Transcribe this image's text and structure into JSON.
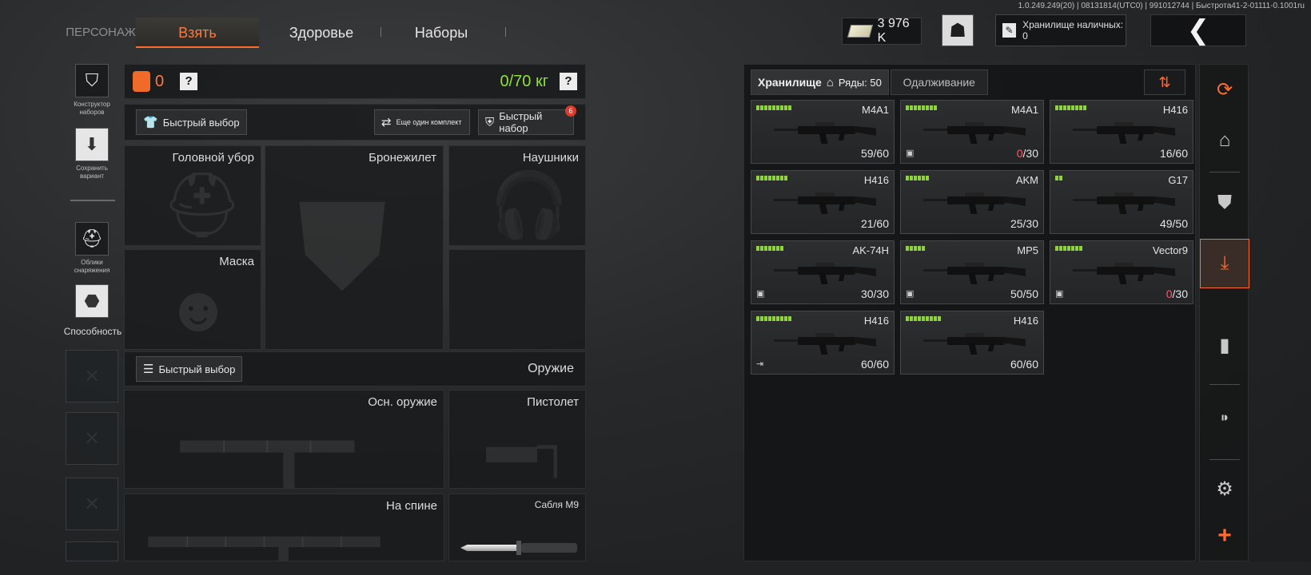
{
  "version": "1.0.249.249(20) | 08131814(UTC0) | 991012744 | Быстрота41-2-01111-0.1001ru",
  "tabs": {
    "character": "ПЕРСОНАЖ",
    "take": "Взять",
    "health": "Здоровье",
    "sets": "Наборы"
  },
  "currency": {
    "amount": "3 976 K"
  },
  "storage_cash": {
    "label": "Хранилище наличных: 0"
  },
  "sidebar": {
    "kit_builder": "Конструктор наборов",
    "save_variant": "Сохранить вариант",
    "gear_skins": "Облики снаряжения",
    "ability": "Способность"
  },
  "loadout": {
    "bag_count": "0",
    "help_glyph": "?",
    "weight": "0/70 кг",
    "quick_select": "Быстрый выбор",
    "another_kit": "Еще один комплект",
    "quick_kit": "Быстрый набор",
    "quick_kit_badge": "6",
    "slots": {
      "headwear": "Головной убор",
      "vest": "Бронежилет",
      "headphones": "Наушники",
      "mask": "Маска"
    },
    "weapons_quick_select": "Быстрый выбор",
    "weapons_title": "Оружие",
    "weapon_slots": {
      "primary": "Осн. оружие",
      "pistol": "Пистолет",
      "back": "На спине",
      "melee": "Сабля М9"
    }
  },
  "storage": {
    "tab_storage": "Хранилище",
    "rows_label": "Ряды: 50",
    "tab_borrow": "Одалживание",
    "items": [
      {
        "name": "M4A1",
        "ammo_current": "59",
        "ammo_max": "/60",
        "empty": false,
        "pips": 9,
        "corner_icon": ""
      },
      {
        "name": "M4A1",
        "ammo_current": "0",
        "ammo_max": "/30",
        "empty": true,
        "pips": 8,
        "corner_icon": "box-icon"
      },
      {
        "name": "H416",
        "ammo_current": "16",
        "ammo_max": "/60",
        "empty": false,
        "pips": 8,
        "corner_icon": ""
      },
      {
        "name": "H416",
        "ammo_current": "21",
        "ammo_max": "/60",
        "empty": false,
        "pips": 8,
        "corner_icon": ""
      },
      {
        "name": "AKM",
        "ammo_current": "25",
        "ammo_max": "/30",
        "empty": false,
        "pips": 6,
        "corner_icon": ""
      },
      {
        "name": "G17",
        "ammo_current": "49",
        "ammo_max": "/50",
        "empty": false,
        "pips": 2,
        "corner_icon": ""
      },
      {
        "name": "AK-74H",
        "ammo_current": "30",
        "ammo_max": "/30",
        "empty": false,
        "pips": 7,
        "corner_icon": "box-icon"
      },
      {
        "name": "MP5",
        "ammo_current": "50",
        "ammo_max": "/50",
        "empty": false,
        "pips": 5,
        "corner_icon": "box-icon"
      },
      {
        "name": "Vector9",
        "ammo_current": "0",
        "ammo_max": "/30",
        "empty": true,
        "pips": 7,
        "corner_icon": "box-icon"
      },
      {
        "name": "H416",
        "ammo_current": "60",
        "ammo_max": "/60",
        "empty": false,
        "pips": 9,
        "corner_icon": "exit-icon"
      },
      {
        "name": "H416",
        "ammo_current": "60",
        "ammo_max": "/60",
        "empty": false,
        "pips": 9,
        "corner_icon": ""
      }
    ]
  },
  "colors": {
    "accent": "#ff6b2e",
    "weight_ok": "#8fe03a",
    "pip": "#8fd43a",
    "empty_ammo": "#ff5a66"
  }
}
